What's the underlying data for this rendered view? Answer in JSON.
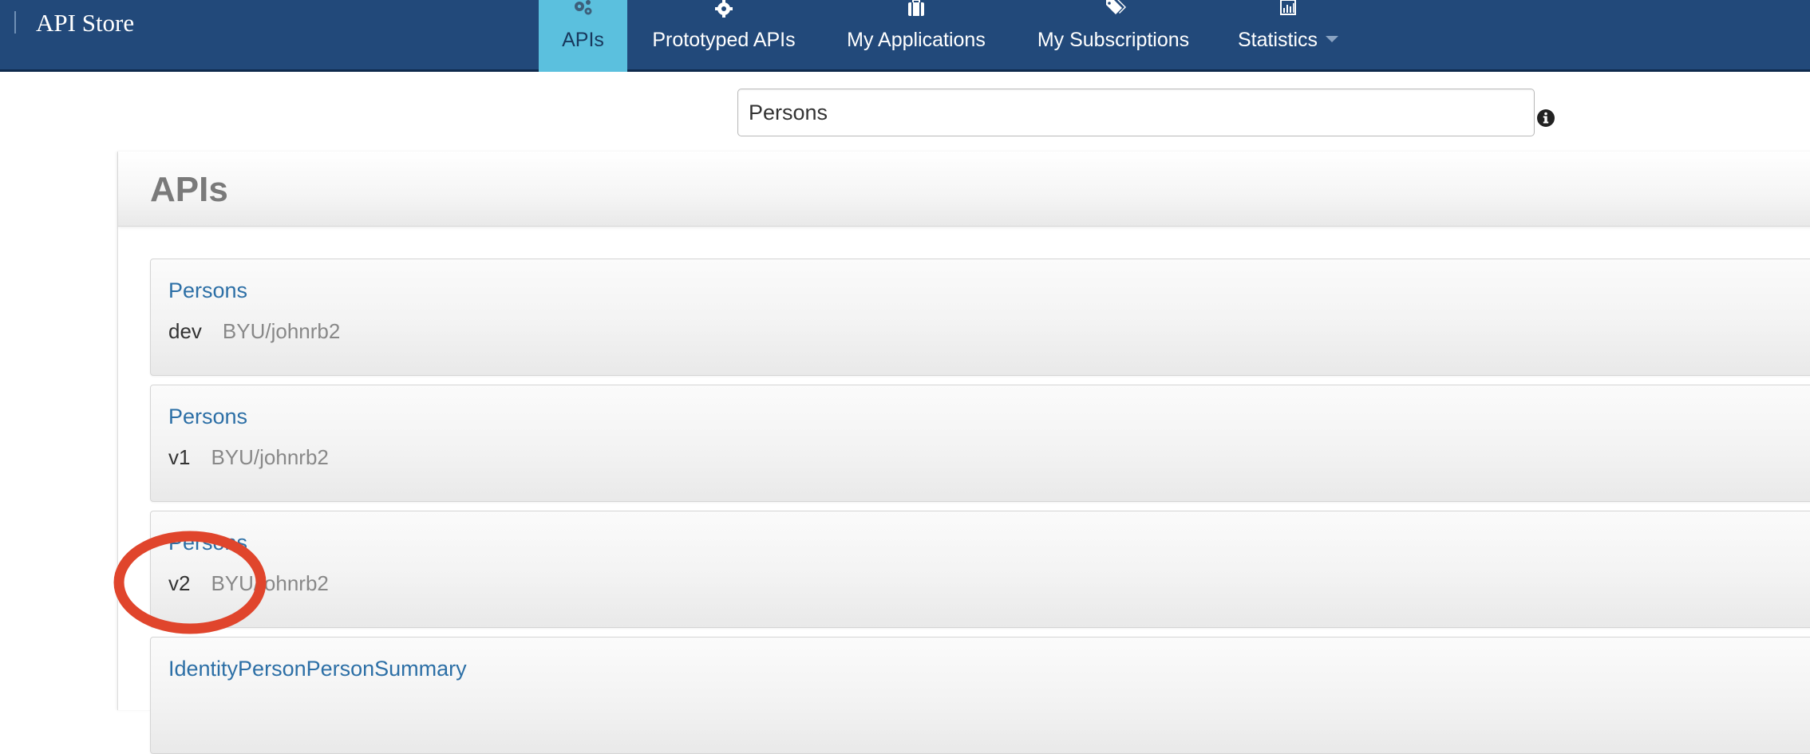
{
  "app": {
    "brand": "API Store"
  },
  "nav": {
    "items": [
      {
        "label": "APIs",
        "icon": "gears-icon",
        "active": true
      },
      {
        "label": "Prototyped APIs",
        "icon": "gear-icon",
        "active": false
      },
      {
        "label": "My Applications",
        "icon": "briefcase-icon",
        "active": false
      },
      {
        "label": "My Subscriptions",
        "icon": "tags-icon",
        "active": false
      },
      {
        "label": "Statistics",
        "icon": "bar-chart-icon",
        "active": false,
        "has_dropdown": true
      }
    ]
  },
  "search": {
    "value": "Persons",
    "info_icon": "info-icon"
  },
  "panel": {
    "title": "APIs"
  },
  "apis": [
    {
      "name": "Persons",
      "version": "dev",
      "owner": "BYU/johnrb2"
    },
    {
      "name": "Persons",
      "version": "v1",
      "owner": "BYU/johnrb2"
    },
    {
      "name": "Persons",
      "version": "v2",
      "owner": "BYU/johnrb2"
    },
    {
      "name": "IdentityPersonPersonSummary",
      "version": "",
      "owner": ""
    }
  ],
  "colors": {
    "nav_bg": "#22497a",
    "nav_active": "#5bc0de",
    "link": "#2c6fa6",
    "annotation": "#e0452c"
  }
}
